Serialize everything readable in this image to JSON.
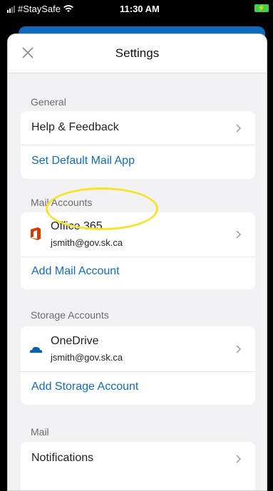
{
  "status_bar": {
    "carrier": "#StaySafe",
    "time": "11:30 AM",
    "battery_glyph": "⚡"
  },
  "nav": {
    "title": "Settings",
    "close_icon": "close-icon"
  },
  "sections": {
    "general": {
      "header": "General",
      "help_feedback": "Help & Feedback",
      "set_default_mail_app": "Set Default Mail App"
    },
    "mail_accounts": {
      "header": "Mail Accounts",
      "account_title": "Office 365",
      "account_email": "jsmith@gov.sk.ca",
      "add_mail_account": "Add Mail Account"
    },
    "storage_accounts": {
      "header": "Storage Accounts",
      "account_title": "OneDrive",
      "account_email": "jsmith@gov.sk.ca",
      "add_storage_account": "Add Storage Account"
    },
    "mail": {
      "header": "Mail",
      "notifications": "Notifications"
    }
  },
  "colors": {
    "accent": "#0f6cbd",
    "office_red": "#d83b01",
    "onedrive_blue": "#0364b8",
    "highlight": "#f5e32e"
  }
}
